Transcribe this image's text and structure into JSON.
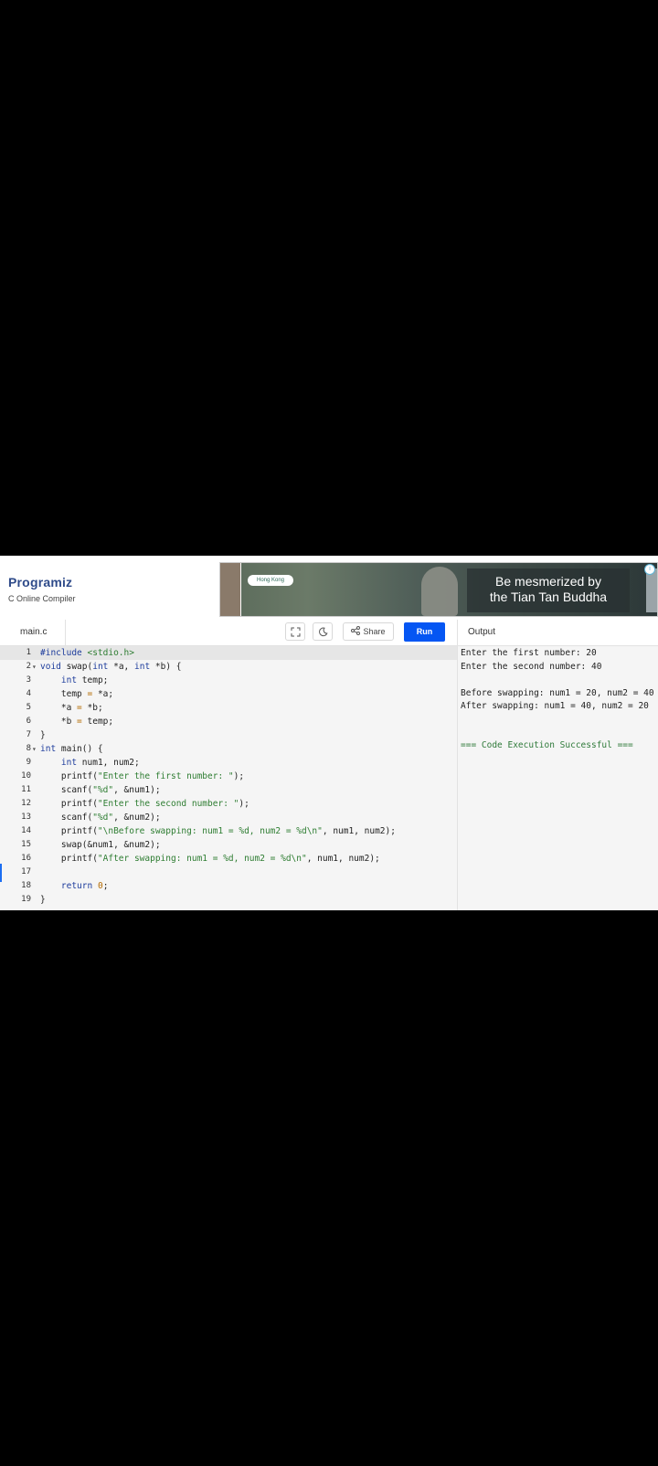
{
  "header": {
    "logo": "Programiz",
    "subtitle": "C Online Compiler"
  },
  "ad": {
    "tag": "Hong Kong",
    "line1": "Be mesmerized by",
    "line2": "the Tian Tan Buddha",
    "info": "i"
  },
  "toolbar": {
    "file_tab": "main.c",
    "share_label": "Share",
    "run_label": "Run",
    "output_label": "Output"
  },
  "editor": {
    "lines": [
      {
        "n": "1",
        "fold": ""
      },
      {
        "n": "2",
        "fold": "▾"
      },
      {
        "n": "3",
        "fold": ""
      },
      {
        "n": "4",
        "fold": ""
      },
      {
        "n": "5",
        "fold": ""
      },
      {
        "n": "6",
        "fold": ""
      },
      {
        "n": "7",
        "fold": ""
      },
      {
        "n": "8",
        "fold": "▾"
      },
      {
        "n": "9",
        "fold": ""
      },
      {
        "n": "10",
        "fold": ""
      },
      {
        "n": "11",
        "fold": ""
      },
      {
        "n": "12",
        "fold": ""
      },
      {
        "n": "13",
        "fold": ""
      },
      {
        "n": "14",
        "fold": ""
      },
      {
        "n": "15",
        "fold": ""
      },
      {
        "n": "16",
        "fold": ""
      },
      {
        "n": "17",
        "fold": ""
      },
      {
        "n": "18",
        "fold": ""
      },
      {
        "n": "19",
        "fold": ""
      }
    ],
    "tokens": {
      "l1": [
        "#include",
        " <stdio.h>"
      ],
      "l2": [
        "void",
        " swap(",
        "int",
        " *a, ",
        "int",
        " *b) {"
      ],
      "l3": [
        "    ",
        "int",
        " temp;"
      ],
      "l4": [
        "    temp ",
        "=",
        " *a;"
      ],
      "l5": [
        "    *a ",
        "=",
        " *b;"
      ],
      "l6": [
        "    *b ",
        "=",
        " temp;"
      ],
      "l7": [
        "}"
      ],
      "l8": [
        "int",
        " main() {"
      ],
      "l9": [
        "    ",
        "int",
        " num1, num2;"
      ],
      "l10": [
        "    printf(",
        "\"Enter the first number: \"",
        ");"
      ],
      "l11": [
        "    scanf(",
        "\"%d\"",
        ", &num1);"
      ],
      "l12": [
        "    printf(",
        "\"Enter the second number: \"",
        ");"
      ],
      "l13": [
        "    scanf(",
        "\"%d\"",
        ", &num2);"
      ],
      "l14": [
        "    printf(",
        "\"\\nBefore swapping: num1 = %d, num2 = %d\\n\"",
        ", num1, num2);"
      ],
      "l15": [
        "    swap(&num1, &num2);"
      ],
      "l16": [
        "    printf(",
        "\"After swapping: num1 = %d, num2 = %d\\n\"",
        ", num1, num2);"
      ],
      "l17": [
        ""
      ],
      "l18": [
        "    ",
        "return",
        " ",
        "0",
        ";"
      ],
      "l19": [
        "}"
      ]
    }
  },
  "output": {
    "lines": [
      "Enter the first number: 20",
      "Enter the second number: 40",
      "",
      "Before swapping: num1 = 20, num2 = 40",
      "After swapping: num1 = 40, num2 = 20",
      "",
      "=== Code Execution Successful ==="
    ]
  }
}
